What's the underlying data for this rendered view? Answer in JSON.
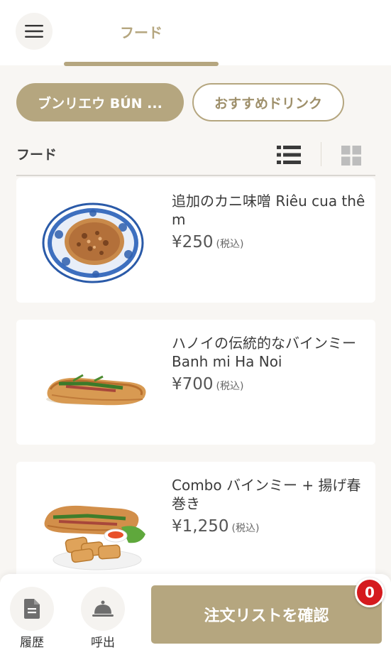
{
  "header": {
    "tab_label": "フード"
  },
  "categories": {
    "active_label": "ブンリエウ BÚN ...",
    "inactive_label": "おすすめドリンク"
  },
  "section": {
    "title": "フード",
    "list_view_icon": "list-view-icon",
    "grid_view_icon": "grid-view-icon"
  },
  "products": [
    {
      "name": "追加のカニ味噌 Riêu cua thêm",
      "price": "¥250",
      "tax": "(税込)",
      "image": "crab-paste-bowl"
    },
    {
      "name": "ハノイの伝統的なバインミー Banh mi Ha Noi",
      "price": "¥700",
      "tax": "(税込)",
      "image": "banh-mi-sandwich"
    },
    {
      "name": "Combo バインミー + 揚げ春巻き",
      "price": "¥1,250",
      "tax": "(税込)",
      "image": "banh-mi-spring-roll-combo"
    }
  ],
  "bottom_bar": {
    "history_label": "履歴",
    "call_label": "呼出",
    "order_button_label": "注文リストを確認",
    "cart_count": "0"
  },
  "colors": {
    "accent": "#b5a67f",
    "badge": "#d51a1e",
    "background": "#f8f6f3"
  }
}
